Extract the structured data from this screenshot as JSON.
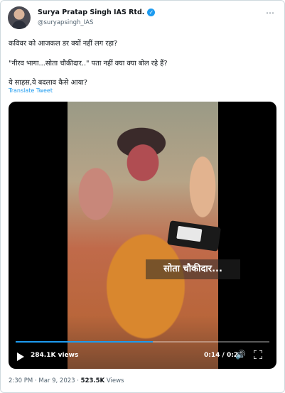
{
  "author": {
    "name": "Surya Pratap Singh IAS Rtd.",
    "handle": "@suryapsingh_IAS",
    "verified": true
  },
  "tweet": {
    "lines": [
      "कविवर को आजकल डर क्यों नहीं लग रहा?",
      "\"नीरव भागा...सोता चौकीदार..\" पता नहीं क्या क्या बोल रहे हैं?",
      "ये साहस,ये बदलाव कैसे आया?"
    ],
    "translate_label": "Translate Tweet"
  },
  "video": {
    "subtitle": "सोता चौकीदार...",
    "views": "284.1K views",
    "time": "0:14 / 0:26",
    "progress": 0.54,
    "accent": "#1d9bf0"
  },
  "meta": {
    "time": "2:30 PM",
    "date": "Mar 9, 2023",
    "views_count": "523.5K",
    "views_label": "Views",
    "separator": "·"
  },
  "icons": {
    "more": "more-icon",
    "play": "play-icon",
    "volume": "volume-icon",
    "fullscreen": "fullscreen-icon",
    "verified": "verified-badge-icon"
  }
}
